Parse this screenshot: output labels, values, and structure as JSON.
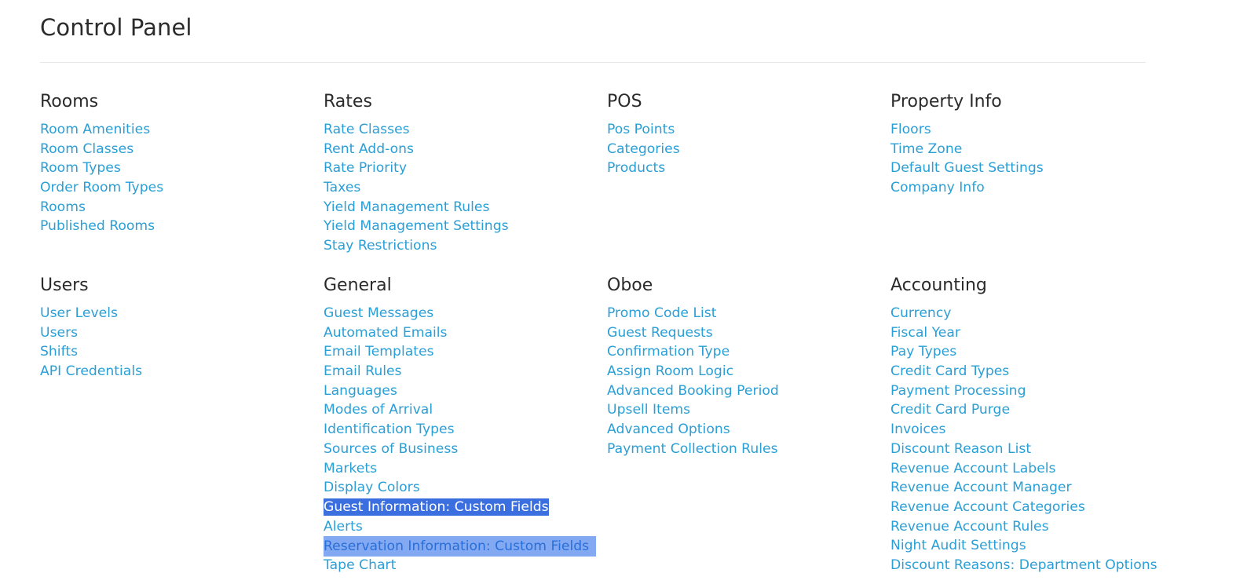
{
  "page": {
    "title": "Control Panel"
  },
  "sections": [
    {
      "heading": "Rooms",
      "links": [
        "Room Amenities",
        "Room Classes",
        "Room Types",
        "Order Room Types",
        "Rooms",
        "Published Rooms"
      ]
    },
    {
      "heading": "Rates",
      "links": [
        "Rate Classes",
        "Rent Add-ons",
        "Rate Priority",
        "Taxes",
        "Yield Management Rules",
        "Yield Management Settings",
        "Stay Restrictions"
      ]
    },
    {
      "heading": "POS",
      "links": [
        "Pos Points",
        "Categories",
        "Products"
      ]
    },
    {
      "heading": "Property Info",
      "links": [
        "Floors",
        "Time Zone",
        "Default Guest Settings",
        "Company Info"
      ]
    },
    {
      "heading": "Users",
      "links": [
        "User Levels",
        "Users",
        "Shifts",
        "API Credentials"
      ]
    },
    {
      "heading": "General",
      "links": [
        "Guest Messages",
        "Automated Emails",
        "Email Templates",
        "Email Rules",
        "Languages",
        "Modes of Arrival",
        "Identification Types",
        "Sources of Business",
        "Markets",
        "Display Colors",
        "Guest Information: Custom Fields",
        "Alerts",
        "Reservation Information: Custom Fields",
        "Tape Chart"
      ]
    },
    {
      "heading": "Oboe",
      "links": [
        "Promo Code List",
        "Guest Requests",
        "Confirmation Type",
        "Assign Room Logic",
        "Advanced Booking Period",
        "Upsell Items",
        "Advanced Options",
        "Payment Collection Rules"
      ]
    },
    {
      "heading": "Accounting",
      "links": [
        "Currency",
        "Fiscal Year",
        "Pay Types",
        "Credit Card Types",
        "Payment Processing",
        "Credit Card Purge",
        "Invoices",
        "Discount Reason List",
        "Revenue Account Labels",
        "Revenue Account Manager",
        "Revenue Account Categories",
        "Revenue Account Rules",
        "Night Audit Settings",
        "Discount Reasons: Department Options"
      ]
    }
  ],
  "colors": {
    "link": "#2a9fd6",
    "heading": "#2b2b2b",
    "selection_strong": "#3b6fe0",
    "selection_soft": "#83a9f2"
  }
}
